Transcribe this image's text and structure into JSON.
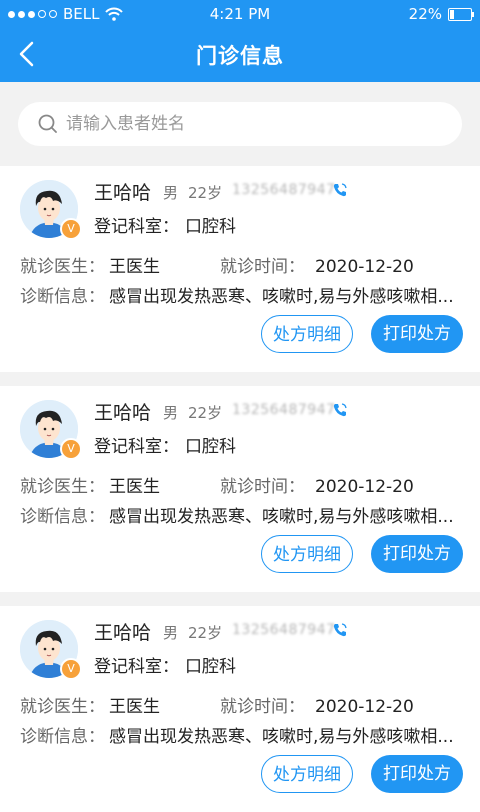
{
  "status_bar": {
    "carrier": "BELL",
    "time": "4:21 PM",
    "battery": "22%",
    "battery_level": 0.22
  },
  "nav": {
    "title": "门诊信息"
  },
  "search": {
    "placeholder": "请输入患者姓名"
  },
  "records": [
    {
      "name": "王哈哈",
      "gender": "男",
      "age": "22岁",
      "phone": "13256487947",
      "dept_label": "登记科室：",
      "dept": "口腔科",
      "doctor_label": "就诊医生：",
      "doctor": "王医生",
      "time_label": "就诊时间：",
      "time": "2020-12-20",
      "diag_label": "诊断信息：",
      "diag": "感冒出现发热恶寒、咳嗽时,易与外感咳嗽相...",
      "badge": "V",
      "detail_button": "处方明细",
      "print_button": "打印处方"
    },
    {
      "name": "王哈哈",
      "gender": "男",
      "age": "22岁",
      "phone": "13256487947",
      "dept_label": "登记科室：",
      "dept": "口腔科",
      "doctor_label": "就诊医生：",
      "doctor": "王医生",
      "time_label": "就诊时间：",
      "time": "2020-12-20",
      "diag_label": "诊断信息：",
      "diag": "感冒出现发热恶寒、咳嗽时,易与外感咳嗽相...",
      "badge": "V",
      "detail_button": "处方明细",
      "print_button": "打印处方"
    },
    {
      "name": "王哈哈",
      "gender": "男",
      "age": "22岁",
      "phone": "13256487947",
      "dept_label": "登记科室：",
      "dept": "口腔科",
      "doctor_label": "就诊医生：",
      "doctor": "王医生",
      "time_label": "就诊时间：",
      "time": "2020-12-20",
      "diag_label": "诊断信息：",
      "diag": "感冒出现发热恶寒、咳嗽时,易与外感咳嗽相...",
      "badge": "V",
      "detail_button": "处方明细",
      "print_button": "打印处方"
    }
  ],
  "icons": {
    "back": "back-arrow-icon",
    "search": "search-icon",
    "phone": "phone-icon",
    "wifi": "wifi-icon",
    "battery": "battery-icon"
  },
  "colors": {
    "primary": "#2196f3",
    "badge": "#f7a13a",
    "background": "#f2f2f2"
  }
}
